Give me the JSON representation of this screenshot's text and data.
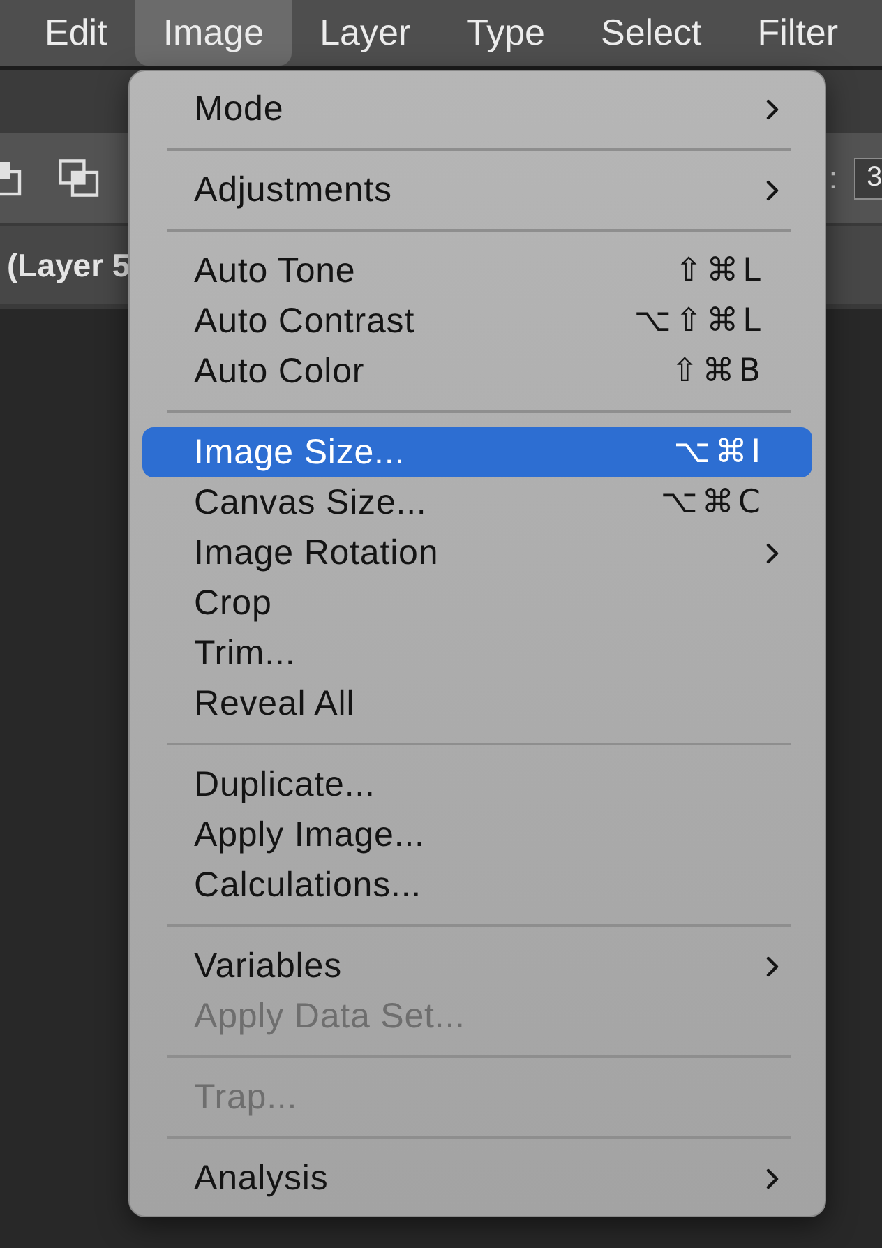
{
  "menu_bar": {
    "items": [
      {
        "label": "Edit",
        "selected": false
      },
      {
        "label": "Image",
        "selected": true
      },
      {
        "label": "Layer",
        "selected": false
      },
      {
        "label": "Type",
        "selected": false
      },
      {
        "label": "Select",
        "selected": false
      },
      {
        "label": "Filter",
        "selected": false
      }
    ]
  },
  "options_bar": {
    "field_label": ":",
    "field_value": "3"
  },
  "document_tab": {
    "title": "(Layer 5"
  },
  "menu": {
    "entries": [
      {
        "kind": "item",
        "label": "Mode",
        "submenu": true,
        "disabled": false,
        "selected": false
      },
      {
        "kind": "separator"
      },
      {
        "kind": "item",
        "label": "Adjustments",
        "submenu": true,
        "disabled": false,
        "selected": false
      },
      {
        "kind": "separator"
      },
      {
        "kind": "item",
        "label": "Auto Tone",
        "shortcut": "⇧⌘L",
        "submenu": false,
        "disabled": false,
        "selected": false
      },
      {
        "kind": "item",
        "label": "Auto Contrast",
        "shortcut": "⌥⇧⌘L",
        "submenu": false,
        "disabled": false,
        "selected": false
      },
      {
        "kind": "item",
        "label": "Auto Color",
        "shortcut": "⇧⌘B",
        "submenu": false,
        "disabled": false,
        "selected": false
      },
      {
        "kind": "separator"
      },
      {
        "kind": "item",
        "label": "Image Size...",
        "shortcut": "⌥⌘I",
        "submenu": false,
        "disabled": false,
        "selected": true
      },
      {
        "kind": "item",
        "label": "Canvas Size...",
        "shortcut": "⌥⌘C",
        "submenu": false,
        "disabled": false,
        "selected": false
      },
      {
        "kind": "item",
        "label": "Image Rotation",
        "submenu": true,
        "disabled": false,
        "selected": false
      },
      {
        "kind": "item",
        "label": "Crop",
        "submenu": false,
        "disabled": false,
        "selected": false
      },
      {
        "kind": "item",
        "label": "Trim...",
        "submenu": false,
        "disabled": false,
        "selected": false
      },
      {
        "kind": "item",
        "label": "Reveal All",
        "submenu": false,
        "disabled": false,
        "selected": false
      },
      {
        "kind": "separator"
      },
      {
        "kind": "item",
        "label": "Duplicate...",
        "submenu": false,
        "disabled": false,
        "selected": false
      },
      {
        "kind": "item",
        "label": "Apply Image...",
        "submenu": false,
        "disabled": false,
        "selected": false
      },
      {
        "kind": "item",
        "label": "Calculations...",
        "submenu": false,
        "disabled": false,
        "selected": false
      },
      {
        "kind": "separator"
      },
      {
        "kind": "item",
        "label": "Variables",
        "submenu": true,
        "disabled": false,
        "selected": false
      },
      {
        "kind": "item",
        "label": "Apply Data Set...",
        "submenu": false,
        "disabled": true,
        "selected": false
      },
      {
        "kind": "separator"
      },
      {
        "kind": "item",
        "label": "Trap...",
        "submenu": false,
        "disabled": true,
        "selected": false
      },
      {
        "kind": "separator"
      },
      {
        "kind": "item",
        "label": "Analysis",
        "submenu": true,
        "disabled": false,
        "selected": false
      }
    ]
  }
}
